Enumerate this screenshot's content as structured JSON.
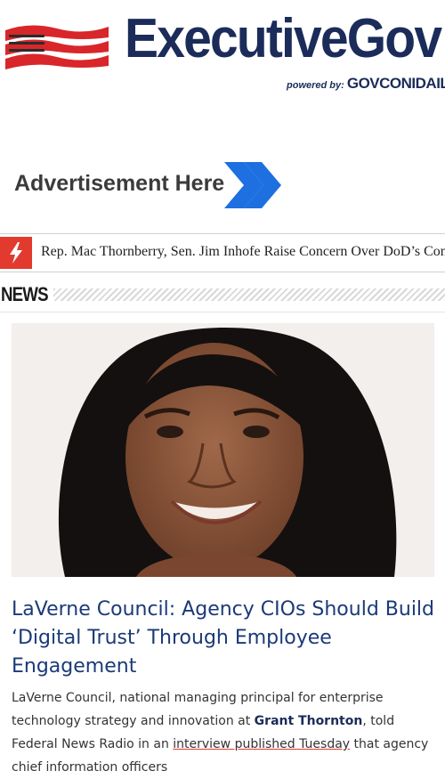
{
  "header": {
    "brand": "ExecutiveGov",
    "powered_label": "powered by:",
    "powered_brand": "GOVCONIDAILY"
  },
  "ad": {
    "text": "Advertisement Here"
  },
  "ticker": {
    "headline": "Rep. Mac Thornberry, Sen. Jim Inhofe Raise Concern Over DoD’s Con"
  },
  "news": {
    "section_title": "NEWS"
  },
  "article": {
    "title": "LaVerne Council: Agency CIOs Should Build ‘Digital Trust’ Through Employee Engagement",
    "excerpt_1": "LaVerne Council, national managing principal for enterprise technology strategy and innovation at ",
    "excerpt_org": "Grant Thornton",
    "excerpt_2": ", told Federal News Radio in an ",
    "excerpt_link": "interview published Tuesday",
    "excerpt_3": " that agency chief information officers"
  },
  "colors": {
    "brand_navy": "#1b2c5a",
    "accent_red": "#e23a2e",
    "link_blue": "#1b3a78",
    "arrow_blue": "#1e6fe0"
  }
}
